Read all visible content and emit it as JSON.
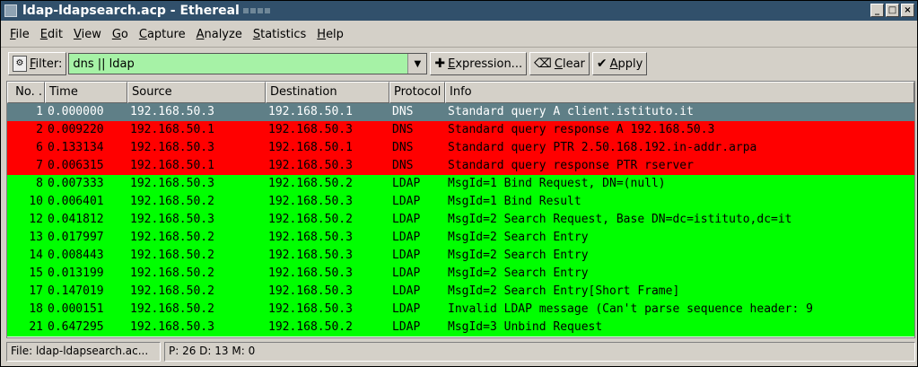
{
  "window": {
    "title": "ldap-ldapsearch.acp - Ethereal"
  },
  "menu": {
    "items": [
      {
        "u": "F",
        "rest": "ile"
      },
      {
        "u": "E",
        "rest": "dit"
      },
      {
        "u": "V",
        "rest": "iew"
      },
      {
        "u": "G",
        "rest": "o"
      },
      {
        "u": "C",
        "rest": "apture"
      },
      {
        "u": "A",
        "rest": "nalyze"
      },
      {
        "u": "S",
        "rest": "tatistics"
      },
      {
        "u": "H",
        "rest": "elp"
      }
    ]
  },
  "toolbar": {
    "filter_label_u": "F",
    "filter_label_rest": "ilter:",
    "filter_value": "dns || ldap",
    "expression_u": "E",
    "expression_rest": "xpression...",
    "clear_u": "C",
    "clear_rest": "lear",
    "apply_u": "A",
    "apply_rest": "pply",
    "filter_bg": "#a6f2a6"
  },
  "packet_list": {
    "columns": [
      "No. .",
      "Time",
      "Source",
      "Destination",
      "Protocol",
      "Info"
    ],
    "rows": [
      {
        "no": "1",
        "time": "0.000000",
        "src": "192.168.50.3",
        "dst": "192.168.50.1",
        "proto": "DNS",
        "info": "Standard query A client.istituto.it",
        "color": "sel"
      },
      {
        "no": "2",
        "time": "0.009220",
        "src": "192.168.50.1",
        "dst": "192.168.50.3",
        "proto": "DNS",
        "info": "Standard query response A 192.168.50.3",
        "color": "red"
      },
      {
        "no": "6",
        "time": "0.133134",
        "src": "192.168.50.3",
        "dst": "192.168.50.1",
        "proto": "DNS",
        "info": "Standard query PTR 2.50.168.192.in-addr.arpa",
        "color": "red"
      },
      {
        "no": "7",
        "time": "0.006315",
        "src": "192.168.50.1",
        "dst": "192.168.50.3",
        "proto": "DNS",
        "info": "Standard query response PTR rserver",
        "color": "red"
      },
      {
        "no": "8",
        "time": "0.007333",
        "src": "192.168.50.3",
        "dst": "192.168.50.2",
        "proto": "LDAP",
        "info": "MsgId=1 Bind Request, DN=(null)",
        "color": "green"
      },
      {
        "no": "10",
        "time": "0.006401",
        "src": "192.168.50.2",
        "dst": "192.168.50.3",
        "proto": "LDAP",
        "info": "MsgId=1 Bind Result",
        "color": "green"
      },
      {
        "no": "12",
        "time": "0.041812",
        "src": "192.168.50.3",
        "dst": "192.168.50.2",
        "proto": "LDAP",
        "info": "MsgId=2 Search Request, Base DN=dc=istituto,dc=it",
        "color": "green"
      },
      {
        "no": "13",
        "time": "0.017997",
        "src": "192.168.50.2",
        "dst": "192.168.50.3",
        "proto": "LDAP",
        "info": "MsgId=2 Search Entry",
        "color": "green"
      },
      {
        "no": "14",
        "time": "0.008443",
        "src": "192.168.50.2",
        "dst": "192.168.50.3",
        "proto": "LDAP",
        "info": "MsgId=2 Search Entry",
        "color": "green"
      },
      {
        "no": "15",
        "time": "0.013199",
        "src": "192.168.50.2",
        "dst": "192.168.50.3",
        "proto": "LDAP",
        "info": "MsgId=2 Search Entry",
        "color": "green"
      },
      {
        "no": "17",
        "time": "0.147019",
        "src": "192.168.50.2",
        "dst": "192.168.50.3",
        "proto": "LDAP",
        "info": "MsgId=2 Search Entry[Short Frame]",
        "color": "green"
      },
      {
        "no": "18",
        "time": "0.000151",
        "src": "192.168.50.2",
        "dst": "192.168.50.3",
        "proto": "LDAP",
        "info": "Invalid LDAP message (Can't parse sequence header: 9",
        "color": "green"
      },
      {
        "no": "21",
        "time": "0.647295",
        "src": "192.168.50.3",
        "dst": "192.168.50.2",
        "proto": "LDAP",
        "info": "MsgId=3 Unbind Request",
        "color": "green"
      }
    ]
  },
  "status": {
    "file": "File: ldap-ldapsearch.ac...",
    "counts": "P: 26 D: 13 M: 0"
  },
  "colors": {
    "selected": "#5f7f87",
    "dns": "#ff0000",
    "ldap": "#00ff00",
    "titlebar": "#31506b"
  }
}
